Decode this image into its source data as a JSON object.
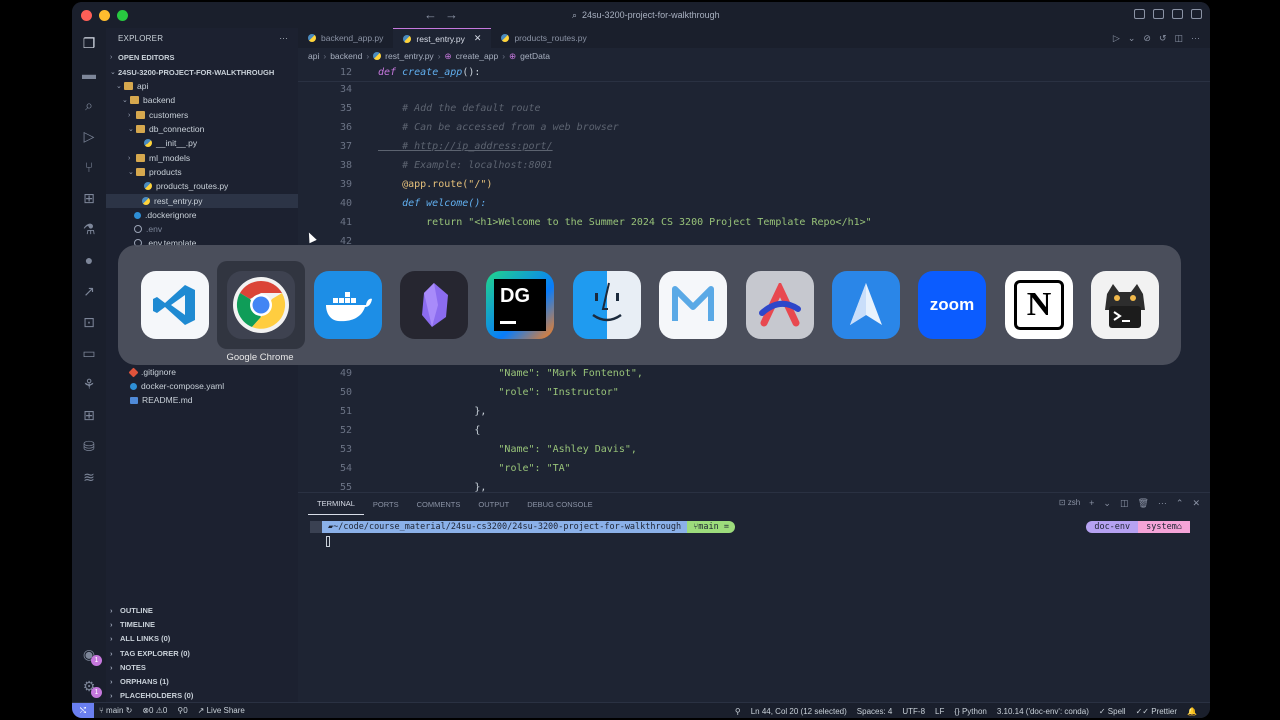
{
  "window": {
    "title": "24su-3200-project-for-walkthrough"
  },
  "sidebar": {
    "header": "EXPLORER",
    "open_editors": "OPEN EDITORS",
    "project": "24SU-3200-PROJECT-FOR-WALKTHROUGH",
    "tree": [
      {
        "label": "api",
        "kind": "folder",
        "open": true
      },
      {
        "label": "backend",
        "kind": "folder",
        "open": true
      },
      {
        "label": "customers",
        "kind": "folder",
        "open": false
      },
      {
        "label": "db_connection",
        "kind": "folder",
        "open": true
      },
      {
        "label": "__init__.py",
        "kind": "py"
      },
      {
        "label": "ml_models",
        "kind": "folder",
        "open": false
      },
      {
        "label": "products",
        "kind": "folder",
        "open": true
      },
      {
        "label": "products_routes.py",
        "kind": "py"
      },
      {
        "label": "rest_entry.py",
        "kind": "py",
        "selected": true
      },
      {
        "label": ".dockerignore",
        "kind": "docker"
      },
      {
        "label": ".env",
        "kind": "gear"
      },
      {
        "label": ".env.template",
        "kind": "gear"
      },
      {
        "label": ".gitignore",
        "kind": "git"
      },
      {
        "label": "docker-compose.yaml",
        "kind": "docker"
      },
      {
        "label": "README.md",
        "kind": "md"
      }
    ],
    "sections": [
      "OUTLINE",
      "TIMELINE",
      "ALL LINKS (0)",
      "TAG EXPLORER (0)",
      "NOTES",
      "ORPHANS (1)",
      "PLACEHOLDERS (0)"
    ]
  },
  "tabs": [
    {
      "label": "backend_app.py",
      "active": false
    },
    {
      "label": "rest_entry.py",
      "active": true
    },
    {
      "label": "products_routes.py",
      "active": false
    }
  ],
  "breadcrumb": [
    "api",
    "backend",
    "rest_entry.py",
    "create_app",
    "getData"
  ],
  "code": {
    "sticky": {
      "num": "12",
      "text": "def create_app():"
    },
    "lines": [
      {
        "num": "34",
        "text": ""
      },
      {
        "num": "35",
        "text": "    # Add the default route"
      },
      {
        "num": "36",
        "text": "    # Can be accessed from a web browser"
      },
      {
        "num": "37",
        "text": "    # http://ip_address:port/"
      },
      {
        "num": "38",
        "text": "    # Example: localhost:8001"
      },
      {
        "num": "39",
        "text": "    @app.route(\"/\")"
      },
      {
        "num": "40",
        "text": "    def welcome():"
      },
      {
        "num": "41",
        "text": "        return \"<h1>Welcome to the Summer 2024 CS 3200 Project Template Repo</h1>\""
      },
      {
        "num": "42",
        "text": ""
      },
      {
        "num": "49",
        "text": "                    \"Name\": \"Mark Fontenot\","
      },
      {
        "num": "50",
        "text": "                    \"role\": \"Instructor\""
      },
      {
        "num": "51",
        "text": "                },"
      },
      {
        "num": "52",
        "text": "                {"
      },
      {
        "num": "53",
        "text": "                    \"Name\": \"Ashley Davis\","
      },
      {
        "num": "54",
        "text": "                    \"role\": \"TA\""
      },
      {
        "num": "55",
        "text": "                },"
      }
    ]
  },
  "panel": {
    "tabs": [
      "TERMINAL",
      "PORTS",
      "COMMENTS",
      "OUTPUT",
      "DEBUG CONSOLE"
    ],
    "shell": "zsh",
    "prompt_path": "~/code/course_material/24su-cs3200/24su-3200-project-for-walkthrough",
    "git_branch": "main =",
    "env": "doc-env",
    "system": "system"
  },
  "statusbar": {
    "branch": "main",
    "errors": "0",
    "warnings": "0",
    "ports": "0",
    "live_share": "Live Share",
    "position": "Ln 44, Col 20 (12 selected)",
    "spaces": "Spaces: 4",
    "encoding": "UTF-8",
    "eol": "LF",
    "language": "Python",
    "interpreter": "3.10.14 ('doc-env': conda)",
    "spell": "Spell",
    "prettier": "Prettier"
  },
  "switcher": {
    "selected_label": "Google Chrome",
    "apps": [
      "vscode",
      "google-chrome",
      "docker",
      "obsidian",
      "datagrip",
      "finder",
      "linear",
      "arc",
      "spark",
      "zoom",
      "notion",
      "terminal"
    ],
    "zoom_text": "zoom",
    "datagrip_text": "DG",
    "notion_text": "N"
  },
  "colors": {
    "accent": "#c678dd",
    "remote": "#6a7ff0"
  }
}
